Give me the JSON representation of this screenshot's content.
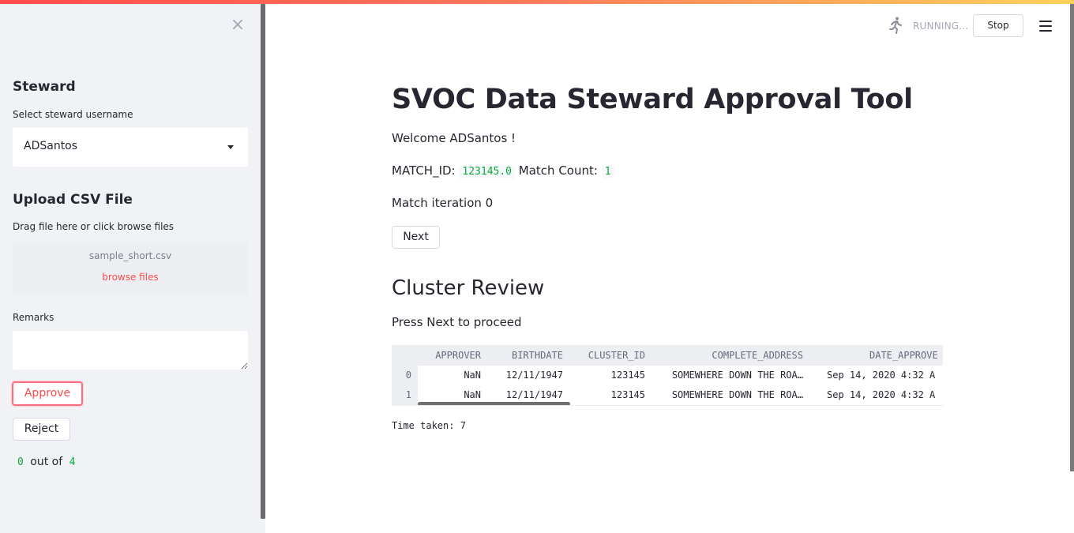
{
  "sidebar": {
    "close_glyph": "×",
    "steward_heading": "Steward",
    "select_label": "Select steward username",
    "select_value": "ADSantos",
    "upload_heading": "Upload CSV File",
    "upload_label": "Drag file here or click browse files",
    "uploaded_file": "sample_short.csv",
    "browse_label": "browse files",
    "remarks_label": "Remarks",
    "remarks_value": "",
    "approve_label": "Approve",
    "reject_label": "Reject",
    "count_current": "0",
    "count_text": "out of",
    "count_total": "4"
  },
  "header": {
    "status_text": "RUNNING...",
    "stop_label": "Stop",
    "status_icon": "running-man-icon",
    "menu_icon": "hamburger-menu-icon"
  },
  "main": {
    "title": "SVOC Data Steward Approval Tool",
    "welcome": "Welcome ADSantos !",
    "match_id_label": "MATCH_ID:",
    "match_id_value": "123145.0",
    "match_count_label": "Match Count:",
    "match_count_value": "1",
    "iteration_text": "Match iteration 0",
    "next_label": "Next",
    "cluster_title": "Cluster Review",
    "cluster_subtitle": "Press Next to proceed",
    "table": {
      "columns": [
        "APPROVER",
        "BIRTHDATE",
        "CLUSTER_ID",
        "COMPLETE_ADDRESS",
        "DATE_APPROVE"
      ],
      "rows": [
        {
          "index": "0",
          "cells": [
            "NaN",
            "12/11/1947",
            "123145",
            "SOMEWHERE DOWN THE ROA…",
            "Sep 14, 2020 4:32 A"
          ]
        },
        {
          "index": "1",
          "cells": [
            "NaN",
            "12/11/1947",
            "123145",
            "SOMEWHERE DOWN THE ROA…",
            "Sep 14, 2020 4:32 A"
          ]
        }
      ]
    },
    "time_taken": "Time taken: 7"
  },
  "colors": {
    "accent": "#ff4b4b",
    "code_green": "#09ab3b",
    "sidebar_bg": "#f0f2f6"
  }
}
